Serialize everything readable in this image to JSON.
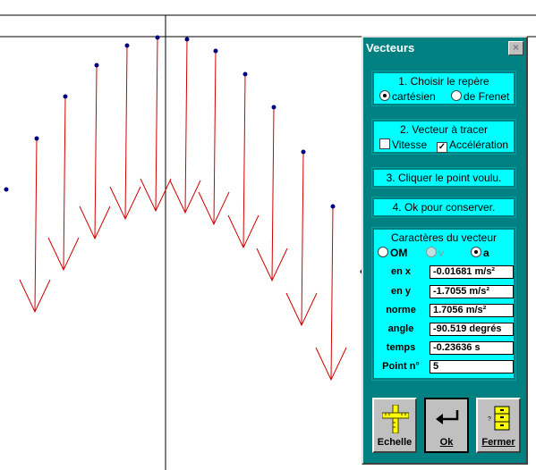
{
  "panel": {
    "title": "Vecteurs",
    "close_label": "×",
    "step1": {
      "heading": "1. Choisir le repère",
      "options": [
        "cartésien",
        "de Frenet"
      ],
      "selected": 0
    },
    "step2": {
      "heading": "2. Vecteur à tracer",
      "vitesse_label": "Vitesse",
      "vitesse_checked": false,
      "acceleration_label": "Accélération",
      "acceleration_checked": true
    },
    "step3": {
      "label": "3. Cliquer le point voulu."
    },
    "step4": {
      "label": "4. Ok pour conserver."
    },
    "characteristics": {
      "heading": "Caractères du vecteur",
      "radio": [
        {
          "label": "OM",
          "selected": false,
          "enabled": true
        },
        {
          "label": "v",
          "selected": false,
          "enabled": false
        },
        {
          "label": "a",
          "selected": true,
          "enabled": true
        }
      ],
      "fields": [
        {
          "label": "en x",
          "value": "-0.01681 m/s²"
        },
        {
          "label": "en y",
          "value": "-1.7055 m/s²"
        },
        {
          "label": "norme",
          "value": "1.7056 m/s²"
        },
        {
          "label": "angle",
          "value": "-90.519 degrés"
        },
        {
          "label": "temps",
          "value": "-0.23636 s"
        },
        {
          "label": "Point n°",
          "value": "5"
        }
      ]
    },
    "buttons": [
      {
        "label": "Echelle",
        "icon": "ruler-icon"
      },
      {
        "label": "Ok",
        "icon": "enter-arrow-icon"
      },
      {
        "label": "Fermer",
        "icon": "cabinet-icon"
      }
    ]
  },
  "plot": {
    "trajectory_color": "#000080",
    "vector_color": "#d00000",
    "axis_color": "#000000"
  }
}
